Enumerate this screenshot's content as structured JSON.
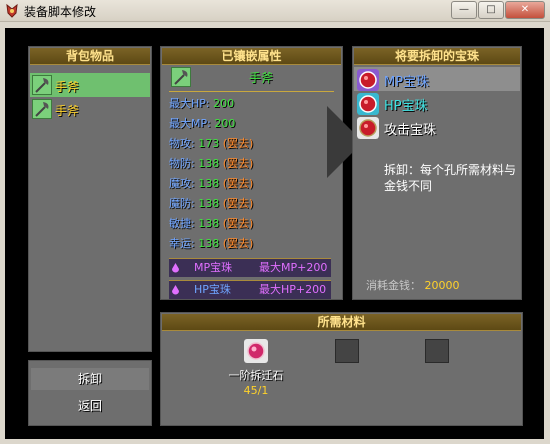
{
  "window": {
    "title": "装备脚本修改"
  },
  "bag_panel": {
    "title": "背包物品",
    "items": [
      {
        "label": "手斧",
        "selected": true
      },
      {
        "label": "手斧",
        "selected": false
      }
    ]
  },
  "attr_panel": {
    "title": "已镶嵌属性",
    "item_name": "手斧",
    "stats": [
      {
        "name": "最大HP:",
        "value": "200",
        "gem": ""
      },
      {
        "name": "最大MP:",
        "value": "200",
        "gem": ""
      },
      {
        "name": "物攻:",
        "value": "173",
        "gem": "(罢去)"
      },
      {
        "name": "物防:",
        "value": "138",
        "gem": "(罢去)"
      },
      {
        "name": "魔攻:",
        "value": "138",
        "gem": "(罢去)"
      },
      {
        "name": "魔防:",
        "value": "138",
        "gem": "(罢去)"
      },
      {
        "name": "敏捷:",
        "value": "138",
        "gem": "(罢去)"
      },
      {
        "name": "幸运:",
        "value": "138",
        "gem": "(罢去)"
      }
    ],
    "gems": [
      {
        "name": "MP宝珠",
        "bonus": "最大MP+200"
      },
      {
        "name": "HP宝珠",
        "bonus": "最大HP+200"
      }
    ]
  },
  "remove_panel": {
    "title": "将要拆卸的宝珠",
    "gems": [
      {
        "label": "MP宝珠",
        "color": "#6fa4ff",
        "selected": true
      },
      {
        "label": "HP宝珠",
        "color": "#3fe2e2",
        "selected": false
      },
      {
        "label": "攻击宝珠",
        "color": "#ffffff",
        "selected": false
      }
    ],
    "note": "拆卸：每个孔所需材料与金钱不同",
    "cost_label": "消耗金钱：",
    "cost_value": "20000"
  },
  "actions": {
    "dismantle": "拆卸",
    "back": "返回"
  },
  "materials_panel": {
    "title": "所需材料",
    "item_name": "一阶拆迁石",
    "count": "45/1"
  }
}
